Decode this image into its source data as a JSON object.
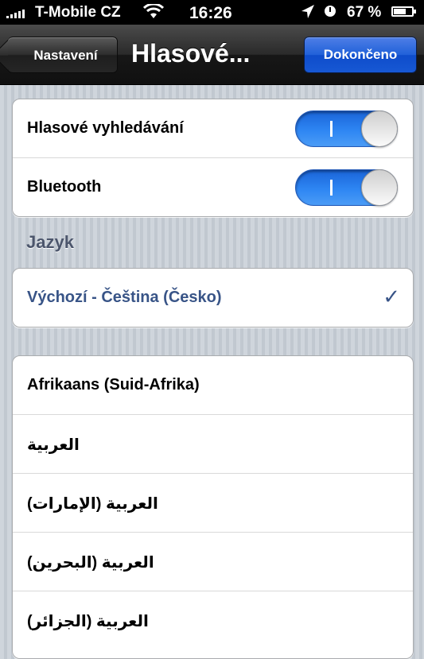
{
  "status_bar": {
    "carrier": "T-Mobile CZ",
    "time": "16:26",
    "battery_percent": "67 %",
    "battery_level": 0.67,
    "icons": [
      "signal-icon",
      "wifi-icon",
      "location-icon",
      "alarm-icon",
      "battery-icon"
    ]
  },
  "nav": {
    "back_label": "Nastavení",
    "title": "Hlasové...",
    "done_label": "Dokončeno"
  },
  "settings": [
    {
      "label": "Hlasové vyhledávání",
      "on": true
    },
    {
      "label": "Bluetooth",
      "on": true
    }
  ],
  "language_section": {
    "header": "Jazyk",
    "selected": "Výchozí - Čeština (Česko)",
    "check": "✓"
  },
  "languages": [
    "Afrikaans (Suid-Afrika)",
    "العربية",
    "العربية (الإمارات)",
    "العربية (البحرين)",
    "العربية (الجزائر)"
  ],
  "colors": {
    "accent": "#2e86f3",
    "selected_text": "#385487",
    "done_button": "#1758d4"
  }
}
